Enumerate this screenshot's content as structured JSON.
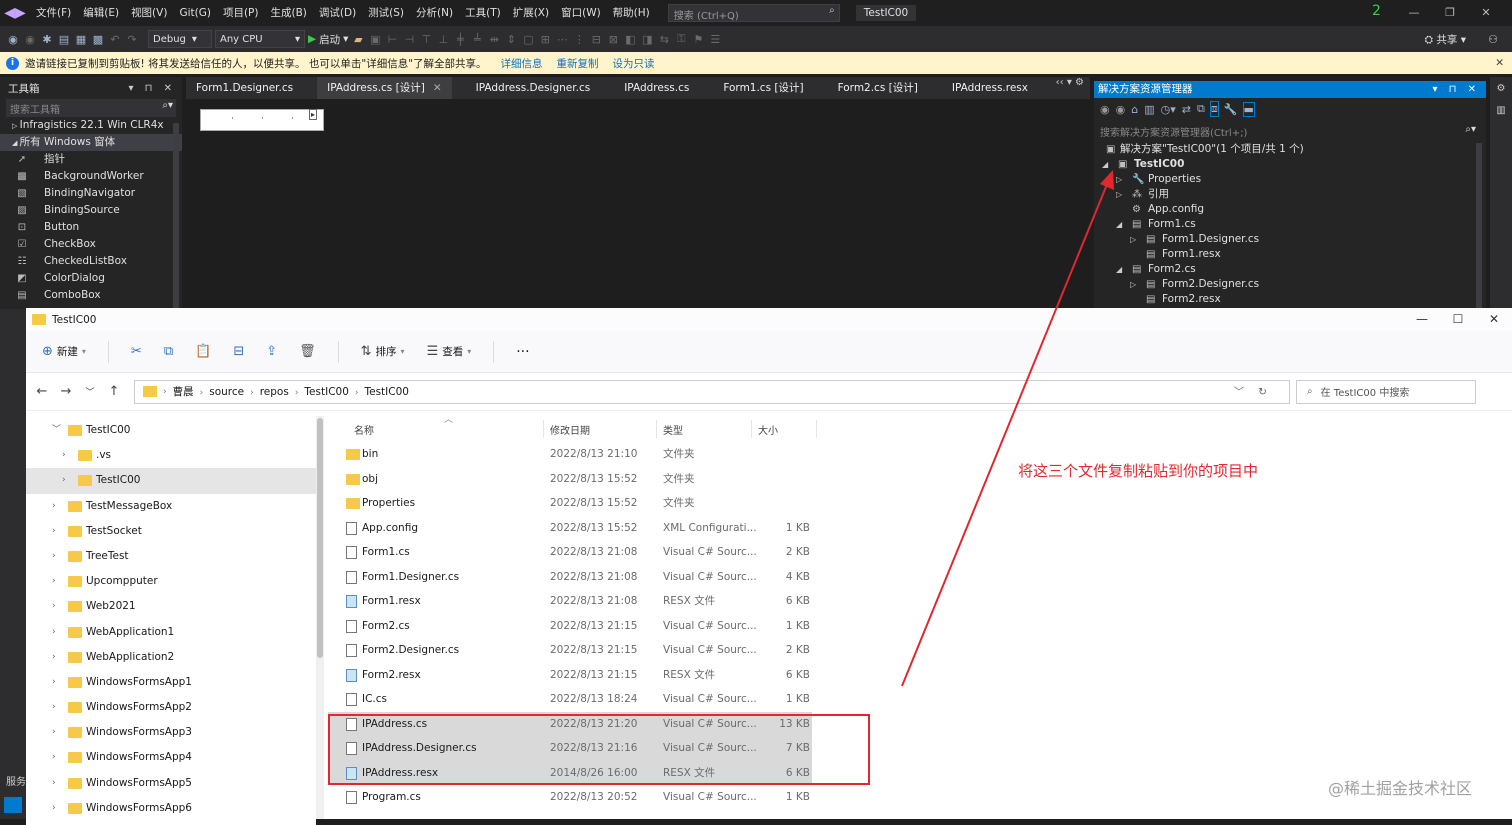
{
  "vs": {
    "menu": [
      "文件(F)",
      "编辑(E)",
      "视图(V)",
      "Git(G)",
      "项目(P)",
      "生成(B)",
      "调试(D)",
      "测试(S)",
      "分析(N)",
      "工具(T)",
      "扩展(X)",
      "窗口(W)",
      "帮助(H)"
    ],
    "search_placeholder": "搜索 (Ctrl+Q)",
    "solution_name": "TestIC00",
    "notif_count": "2",
    "config": "Debug",
    "platform": "Any CPU",
    "start_label": "启动",
    "share_label": "共享"
  },
  "infobar": {
    "text": "邀请链接已复制到剪贴板! 将其发送给信任的人，以便共享。 也可以单击\"详细信息\"了解全部共享。",
    "link1": "详细信息",
    "link2": "重新复制",
    "link3": "设为只读"
  },
  "toolbox": {
    "title": "工具箱",
    "search_placeholder": "搜索工具箱",
    "groups": [
      "Infragistics 22.1 Win CLR4x",
      "所有 Windows 窗体"
    ],
    "items": [
      "指针",
      "BackgroundWorker",
      "BindingNavigator",
      "BindingSource",
      "Button",
      "CheckBox",
      "CheckedListBox",
      "ColorDialog",
      "ComboBox"
    ]
  },
  "tabs": [
    {
      "label": "Form1.Designer.cs",
      "active": false
    },
    {
      "label": "IPAddress.cs [设计]",
      "active": true
    },
    {
      "label": "IPAddress.Designer.cs",
      "active": false
    },
    {
      "label": "IPAddress.cs",
      "active": false
    },
    {
      "label": "Form1.cs [设计]",
      "active": false
    },
    {
      "label": "Form2.cs [设计]",
      "active": false
    },
    {
      "label": "IPAddress.resx",
      "active": false
    }
  ],
  "solution_explorer": {
    "title": "解决方案资源管理器",
    "search_placeholder": "搜索解决方案资源管理器(Ctrl+;)",
    "solution_label": "解决方案\"TestIC00\"(1 个项目/共 1 个)",
    "nodes": [
      {
        "label": "TestIC00",
        "level": 1,
        "arrow": "◢"
      },
      {
        "label": "Properties",
        "level": 2,
        "arrow": "▷"
      },
      {
        "label": "引用",
        "level": 2,
        "arrow": "▷"
      },
      {
        "label": "App.config",
        "level": 2,
        "arrow": ""
      },
      {
        "label": "Form1.cs",
        "level": 2,
        "arrow": "◢"
      },
      {
        "label": "Form1.Designer.cs",
        "level": 3,
        "arrow": "▷"
      },
      {
        "label": "Form1.resx",
        "level": 3,
        "arrow": ""
      },
      {
        "label": "Form2.cs",
        "level": 2,
        "arrow": "◢"
      },
      {
        "label": "Form2.Designer.cs",
        "level": 3,
        "arrow": "▷"
      },
      {
        "label": "Form2.resx",
        "level": 3,
        "arrow": ""
      }
    ]
  },
  "explorer": {
    "title": "TestIC00",
    "commands": {
      "new": "新建",
      "sort": "排序",
      "view": "查看"
    },
    "breadcrumb": [
      "曹晨",
      "source",
      "repos",
      "TestIC00",
      "TestIC00"
    ],
    "search_placeholder": "在 TestIC00 中搜索",
    "nav_items": [
      {
        "label": "TestIC00",
        "level": 0,
        "arrow": "﹀",
        "selected": false
      },
      {
        "label": ".vs",
        "level": 1,
        "arrow": "›",
        "selected": false
      },
      {
        "label": "TestIC00",
        "level": 1,
        "arrow": "›",
        "selected": true
      },
      {
        "label": "TestMessageBox",
        "level": 0,
        "arrow": "›",
        "selected": false
      },
      {
        "label": "TestSocket",
        "level": 0,
        "arrow": "›",
        "selected": false
      },
      {
        "label": "TreeTest",
        "level": 0,
        "arrow": "›",
        "selected": false
      },
      {
        "label": "Upcompputer",
        "level": 0,
        "arrow": "›",
        "selected": false
      },
      {
        "label": "Web2021",
        "level": 0,
        "arrow": "›",
        "selected": false
      },
      {
        "label": "WebApplication1",
        "level": 0,
        "arrow": "›",
        "selected": false
      },
      {
        "label": "WebApplication2",
        "level": 0,
        "arrow": "›",
        "selected": false
      },
      {
        "label": "WindowsFormsApp1",
        "level": 0,
        "arrow": "›",
        "selected": false
      },
      {
        "label": "WindowsFormsApp2",
        "level": 0,
        "arrow": "›",
        "selected": false
      },
      {
        "label": "WindowsFormsApp3",
        "level": 0,
        "arrow": "›",
        "selected": false
      },
      {
        "label": "WindowsFormsApp4",
        "level": 0,
        "arrow": "›",
        "selected": false
      },
      {
        "label": "WindowsFormsApp5",
        "level": 0,
        "arrow": "›",
        "selected": false
      },
      {
        "label": "WindowsFormsApp6",
        "level": 0,
        "arrow": "›",
        "selected": false
      }
    ],
    "columns": {
      "name": "名称",
      "date": "修改日期",
      "type": "类型",
      "size": "大小"
    },
    "files": [
      {
        "name": "bin",
        "date": "2022/8/13 21:10",
        "type": "文件夹",
        "size": "",
        "kind": "folder",
        "selected": false
      },
      {
        "name": "obj",
        "date": "2022/8/13 15:52",
        "type": "文件夹",
        "size": "",
        "kind": "folder",
        "selected": false
      },
      {
        "name": "Properties",
        "date": "2022/8/13 15:52",
        "type": "文件夹",
        "size": "",
        "kind": "folder",
        "selected": false
      },
      {
        "name": "App.config",
        "date": "2022/8/13 15:52",
        "type": "XML Configurati...",
        "size": "1 KB",
        "kind": "file",
        "selected": false
      },
      {
        "name": "Form1.cs",
        "date": "2022/8/13 21:08",
        "type": "Visual C# Sourc...",
        "size": "2 KB",
        "kind": "file",
        "selected": false
      },
      {
        "name": "Form1.Designer.cs",
        "date": "2022/8/13 21:08",
        "type": "Visual C# Sourc...",
        "size": "4 KB",
        "kind": "file",
        "selected": false
      },
      {
        "name": "Form1.resx",
        "date": "2022/8/13 21:08",
        "type": "RESX 文件",
        "size": "6 KB",
        "kind": "resx",
        "selected": false
      },
      {
        "name": "Form2.cs",
        "date": "2022/8/13 21:15",
        "type": "Visual C# Sourc...",
        "size": "1 KB",
        "kind": "file",
        "selected": false
      },
      {
        "name": "Form2.Designer.cs",
        "date": "2022/8/13 21:15",
        "type": "Visual C# Sourc...",
        "size": "2 KB",
        "kind": "file",
        "selected": false
      },
      {
        "name": "Form2.resx",
        "date": "2022/8/13 21:15",
        "type": "RESX 文件",
        "size": "6 KB",
        "kind": "resx",
        "selected": false
      },
      {
        "name": "IC.cs",
        "date": "2022/8/13 18:24",
        "type": "Visual C# Sourc...",
        "size": "1 KB",
        "kind": "file",
        "selected": false
      },
      {
        "name": "IPAddress.cs",
        "date": "2022/8/13 21:20",
        "type": "Visual C# Sourc...",
        "size": "13 KB",
        "kind": "file",
        "selected": true
      },
      {
        "name": "IPAddress.Designer.cs",
        "date": "2022/8/13 21:16",
        "type": "Visual C# Sourc...",
        "size": "7 KB",
        "kind": "file",
        "selected": true
      },
      {
        "name": "IPAddress.resx",
        "date": "2014/8/26 16:00",
        "type": "RESX 文件",
        "size": "6 KB",
        "kind": "resx",
        "selected": true
      },
      {
        "name": "Program.cs",
        "date": "2022/8/13 20:52",
        "type": "Visual C# Sourc...",
        "size": "1 KB",
        "kind": "file",
        "selected": false
      }
    ]
  },
  "annotation": "将这三个文件复制粘贴到你的项目中",
  "watermark": "@稀土掘金技术社区",
  "bottom_label": "服务",
  "colors": {
    "accent": "#007acc",
    "annotation": "#e0282e",
    "folder": "#f7c948"
  }
}
